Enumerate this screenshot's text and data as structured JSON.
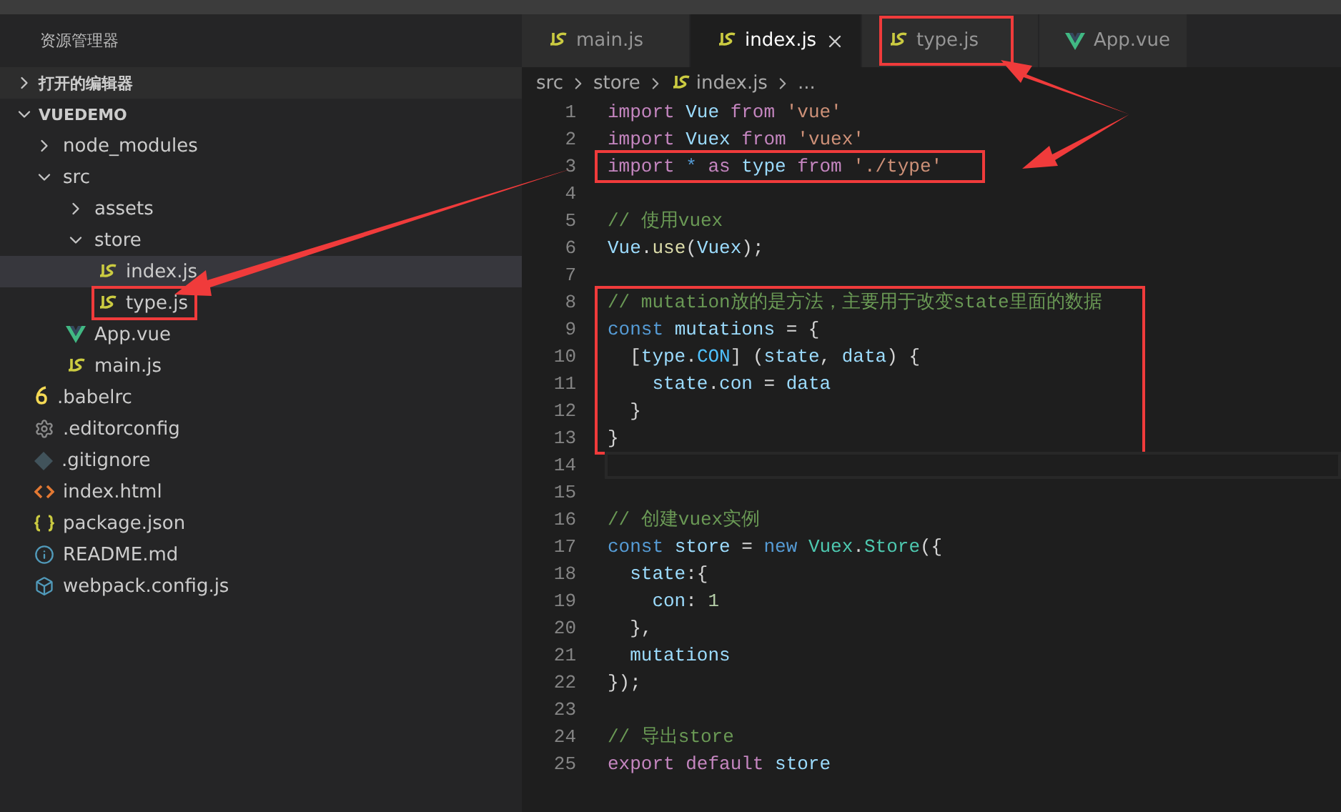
{
  "sidebar": {
    "title": "资源管理器",
    "sections": [
      {
        "label": "打开的编辑器",
        "expanded": false
      },
      {
        "label": "VUEDEMO",
        "expanded": true
      }
    ],
    "tree": [
      {
        "label": "node_modules",
        "kind": "folder",
        "expanded": false,
        "selected": false,
        "annotated": false
      },
      {
        "label": "src",
        "kind": "folder",
        "expanded": true,
        "selected": false,
        "annotated": false,
        "children": [
          {
            "label": "assets",
            "kind": "folder",
            "expanded": false,
            "selected": false,
            "annotated": false
          },
          {
            "label": "store",
            "kind": "folder",
            "expanded": true,
            "selected": false,
            "annotated": false,
            "children": [
              {
                "label": "index.js",
                "kind": "js",
                "selected": true,
                "annotated": false
              },
              {
                "label": "type.js",
                "kind": "js",
                "selected": false,
                "annotated": true
              }
            ]
          },
          {
            "label": "App.vue",
            "kind": "vue",
            "selected": false,
            "annotated": false
          },
          {
            "label": "main.js",
            "kind": "js",
            "selected": false,
            "annotated": false
          }
        ]
      },
      {
        "label": ".babelrc",
        "kind": "babel",
        "selected": false,
        "annotated": false
      },
      {
        "label": ".editorconfig",
        "kind": "config",
        "selected": false,
        "annotated": false
      },
      {
        "label": ".gitignore",
        "kind": "git",
        "selected": false,
        "annotated": false
      },
      {
        "label": "index.html",
        "kind": "html",
        "selected": false,
        "annotated": false
      },
      {
        "label": "package.json",
        "kind": "json",
        "selected": false,
        "annotated": false
      },
      {
        "label": "README.md",
        "kind": "info",
        "selected": false,
        "annotated": false
      },
      {
        "label": "webpack.config.js",
        "kind": "webpack",
        "selected": false,
        "annotated": false
      }
    ]
  },
  "tabs": [
    {
      "label": "main.js",
      "kind": "js",
      "selected": false,
      "annotated": false
    },
    {
      "label": "index.js",
      "kind": "js",
      "selected": true,
      "annotated": false
    },
    {
      "label": "type.js",
      "kind": "js",
      "selected": false,
      "annotated": true
    },
    {
      "label": "App.vue",
      "kind": "vue",
      "selected": false,
      "annotated": false
    }
  ],
  "breadcrumb": [
    "src",
    "store",
    "index.js",
    "..."
  ],
  "code_blocks": [
    {
      "annotated": false,
      "lines": [
        {
          "number": "1",
          "current": false,
          "tokens": [
            {
              "kind": "keyword",
              "text": "import "
            },
            {
              "kind": "variable",
              "text": "Vue "
            },
            {
              "kind": "keyword",
              "text": "from "
            },
            {
              "kind": "string",
              "text": "'vue'"
            }
          ]
        },
        {
          "number": "2",
          "current": false,
          "tokens": [
            {
              "kind": "keyword",
              "text": "import "
            },
            {
              "kind": "variable",
              "text": "Vuex "
            },
            {
              "kind": "keyword",
              "text": "from "
            },
            {
              "kind": "string",
              "text": "'vuex'"
            }
          ]
        }
      ]
    },
    {
      "annotated": true,
      "lines": [
        {
          "number": "3",
          "current": false,
          "tokens": [
            {
              "kind": "keyword",
              "text": "import "
            },
            {
              "kind": "storage",
              "text": "* "
            },
            {
              "kind": "keyword",
              "text": "as "
            },
            {
              "kind": "variable",
              "text": "type "
            },
            {
              "kind": "keyword",
              "text": "from "
            },
            {
              "kind": "string",
              "text": "'./type'"
            }
          ]
        }
      ]
    },
    {
      "annotated": false,
      "lines": [
        {
          "number": "4",
          "current": false
        },
        {
          "number": "5",
          "current": false,
          "tokens": [
            {
              "kind": "comment",
              "text": "// 使用vuex"
            }
          ]
        },
        {
          "number": "6",
          "current": false,
          "tokens": [
            {
              "kind": "variable",
              "text": "Vue"
            },
            {
              "kind": "plain",
              "text": "."
            },
            {
              "kind": "function",
              "text": "use"
            },
            {
              "kind": "plain",
              "text": "("
            },
            {
              "kind": "variable",
              "text": "Vuex"
            },
            {
              "kind": "plain",
              "text": ");"
            }
          ]
        },
        {
          "number": "7",
          "current": false
        }
      ]
    },
    {
      "annotated": true,
      "lines": [
        {
          "number": "8",
          "current": false,
          "tokens": [
            {
              "kind": "comment",
              "text": "// mutation放的是方法，主要用于改变state里面的数据"
            }
          ]
        },
        {
          "number": "9",
          "current": false,
          "tokens": [
            {
              "kind": "storage",
              "text": "const "
            },
            {
              "kind": "variable",
              "text": "mutations"
            },
            {
              "kind": "plain",
              "text": " = {"
            }
          ]
        },
        {
          "number": "10",
          "current": false,
          "tokens": [
            {
              "kind": "plain",
              "text": "  ["
            },
            {
              "kind": "variable",
              "text": "type"
            },
            {
              "kind": "plain",
              "text": "."
            },
            {
              "kind": "constant",
              "text": "CON"
            },
            {
              "kind": "plain",
              "text": "] ("
            },
            {
              "kind": "variable",
              "text": "state"
            },
            {
              "kind": "plain",
              "text": ", "
            },
            {
              "kind": "variable",
              "text": "data"
            },
            {
              "kind": "plain",
              "text": ") {"
            }
          ]
        },
        {
          "number": "11",
          "current": false,
          "tokens": [
            {
              "kind": "variable",
              "text": "    state"
            },
            {
              "kind": "plain",
              "text": "."
            },
            {
              "kind": "variable",
              "text": "con"
            },
            {
              "kind": "plain",
              "text": " = "
            },
            {
              "kind": "variable",
              "text": "data"
            }
          ]
        },
        {
          "number": "12",
          "current": false,
          "tokens": [
            {
              "kind": "plain",
              "text": "  }"
            }
          ]
        },
        {
          "number": "13",
          "current": false,
          "tokens": [
            {
              "kind": "plain",
              "text": "}"
            }
          ]
        }
      ]
    },
    {
      "annotated": false,
      "lines": [
        {
          "number": "14",
          "current": true
        },
        {
          "number": "15",
          "current": false
        },
        {
          "number": "16",
          "current": false,
          "tokens": [
            {
              "kind": "comment",
              "text": "// 创建vuex实例"
            }
          ]
        },
        {
          "number": "17",
          "current": false,
          "tokens": [
            {
              "kind": "storage",
              "text": "const "
            },
            {
              "kind": "variable",
              "text": "store"
            },
            {
              "kind": "plain",
              "text": " = "
            },
            {
              "kind": "storage",
              "text": "new "
            },
            {
              "kind": "class",
              "text": "Vuex"
            },
            {
              "kind": "plain",
              "text": "."
            },
            {
              "kind": "class",
              "text": "Store"
            },
            {
              "kind": "plain",
              "text": "({"
            }
          ]
        },
        {
          "number": "18",
          "current": false,
          "tokens": [
            {
              "kind": "variable",
              "text": "  state"
            },
            {
              "kind": "plain",
              "text": ":{"
            }
          ]
        },
        {
          "number": "19",
          "current": false,
          "tokens": [
            {
              "kind": "variable",
              "text": "    con"
            },
            {
              "kind": "plain",
              "text": ": "
            },
            {
              "kind": "number",
              "text": "1"
            }
          ]
        },
        {
          "number": "20",
          "current": false,
          "tokens": [
            {
              "kind": "plain",
              "text": "  },"
            }
          ]
        },
        {
          "number": "21",
          "current": false,
          "tokens": [
            {
              "kind": "variable",
              "text": "  mutations"
            }
          ]
        },
        {
          "number": "22",
          "current": false,
          "tokens": [
            {
              "kind": "plain",
              "text": "});"
            }
          ]
        },
        {
          "number": "23",
          "current": false
        },
        {
          "number": "24",
          "current": false,
          "tokens": [
            {
              "kind": "comment",
              "text": "// 导出store"
            }
          ]
        },
        {
          "number": "25",
          "current": false,
          "tokens": [
            {
              "kind": "keyword",
              "text": "export "
            },
            {
              "kind": "keyword",
              "text": "default "
            },
            {
              "kind": "variable",
              "text": "store"
            }
          ]
        }
      ]
    }
  ]
}
